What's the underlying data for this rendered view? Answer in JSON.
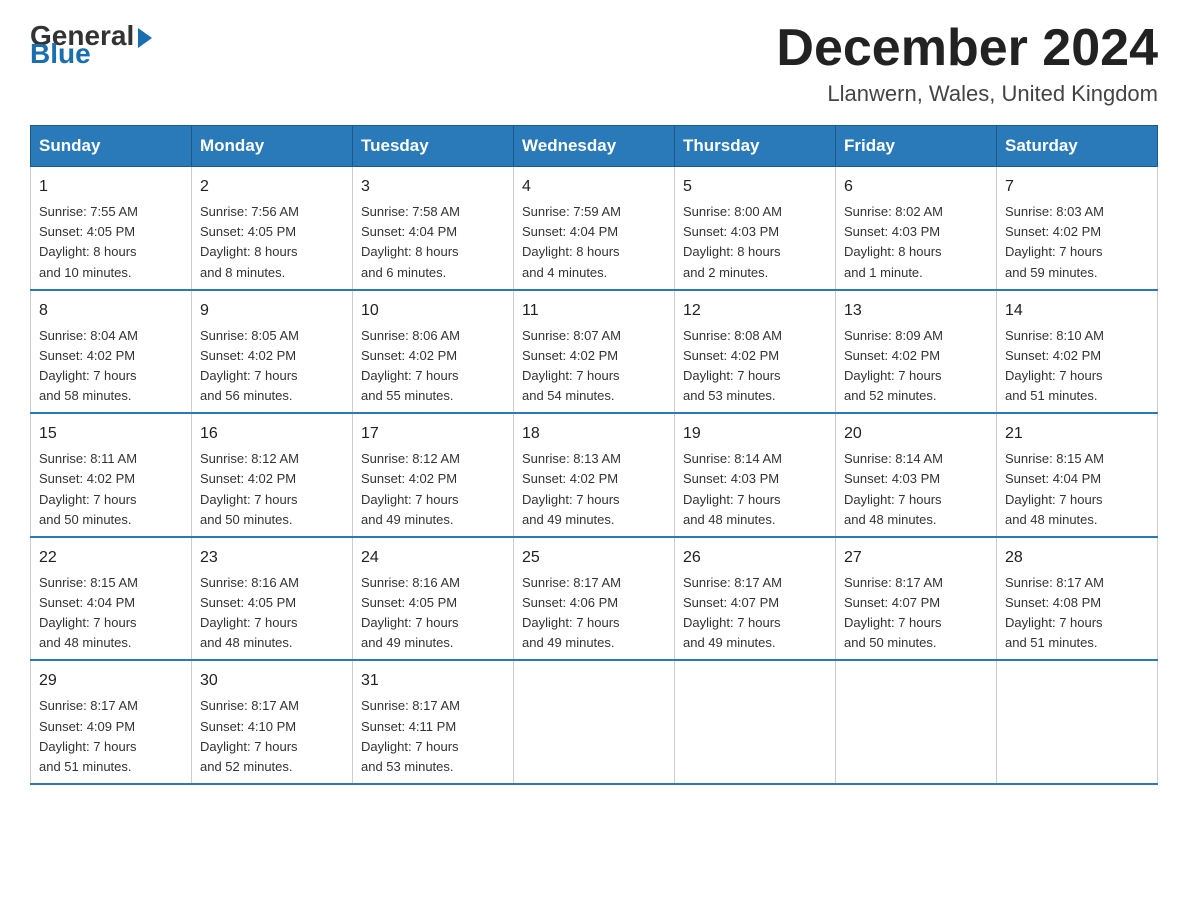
{
  "logo": {
    "general": "General",
    "blue": "Blue"
  },
  "title": "December 2024",
  "subtitle": "Llanwern, Wales, United Kingdom",
  "headers": [
    "Sunday",
    "Monday",
    "Tuesday",
    "Wednesday",
    "Thursday",
    "Friday",
    "Saturday"
  ],
  "weeks": [
    [
      {
        "day": "1",
        "sunrise": "7:55 AM",
        "sunset": "4:05 PM",
        "daylight": "8 hours and 10 minutes."
      },
      {
        "day": "2",
        "sunrise": "7:56 AM",
        "sunset": "4:05 PM",
        "daylight": "8 hours and 8 minutes."
      },
      {
        "day": "3",
        "sunrise": "7:58 AM",
        "sunset": "4:04 PM",
        "daylight": "8 hours and 6 minutes."
      },
      {
        "day": "4",
        "sunrise": "7:59 AM",
        "sunset": "4:04 PM",
        "daylight": "8 hours and 4 minutes."
      },
      {
        "day": "5",
        "sunrise": "8:00 AM",
        "sunset": "4:03 PM",
        "daylight": "8 hours and 2 minutes."
      },
      {
        "day": "6",
        "sunrise": "8:02 AM",
        "sunset": "4:03 PM",
        "daylight": "8 hours and 1 minute."
      },
      {
        "day": "7",
        "sunrise": "8:03 AM",
        "sunset": "4:02 PM",
        "daylight": "7 hours and 59 minutes."
      }
    ],
    [
      {
        "day": "8",
        "sunrise": "8:04 AM",
        "sunset": "4:02 PM",
        "daylight": "7 hours and 58 minutes."
      },
      {
        "day": "9",
        "sunrise": "8:05 AM",
        "sunset": "4:02 PM",
        "daylight": "7 hours and 56 minutes."
      },
      {
        "day": "10",
        "sunrise": "8:06 AM",
        "sunset": "4:02 PM",
        "daylight": "7 hours and 55 minutes."
      },
      {
        "day": "11",
        "sunrise": "8:07 AM",
        "sunset": "4:02 PM",
        "daylight": "7 hours and 54 minutes."
      },
      {
        "day": "12",
        "sunrise": "8:08 AM",
        "sunset": "4:02 PM",
        "daylight": "7 hours and 53 minutes."
      },
      {
        "day": "13",
        "sunrise": "8:09 AM",
        "sunset": "4:02 PM",
        "daylight": "7 hours and 52 minutes."
      },
      {
        "day": "14",
        "sunrise": "8:10 AM",
        "sunset": "4:02 PM",
        "daylight": "7 hours and 51 minutes."
      }
    ],
    [
      {
        "day": "15",
        "sunrise": "8:11 AM",
        "sunset": "4:02 PM",
        "daylight": "7 hours and 50 minutes."
      },
      {
        "day": "16",
        "sunrise": "8:12 AM",
        "sunset": "4:02 PM",
        "daylight": "7 hours and 50 minutes."
      },
      {
        "day": "17",
        "sunrise": "8:12 AM",
        "sunset": "4:02 PM",
        "daylight": "7 hours and 49 minutes."
      },
      {
        "day": "18",
        "sunrise": "8:13 AM",
        "sunset": "4:02 PM",
        "daylight": "7 hours and 49 minutes."
      },
      {
        "day": "19",
        "sunrise": "8:14 AM",
        "sunset": "4:03 PM",
        "daylight": "7 hours and 48 minutes."
      },
      {
        "day": "20",
        "sunrise": "8:14 AM",
        "sunset": "4:03 PM",
        "daylight": "7 hours and 48 minutes."
      },
      {
        "day": "21",
        "sunrise": "8:15 AM",
        "sunset": "4:04 PM",
        "daylight": "7 hours and 48 minutes."
      }
    ],
    [
      {
        "day": "22",
        "sunrise": "8:15 AM",
        "sunset": "4:04 PM",
        "daylight": "7 hours and 48 minutes."
      },
      {
        "day": "23",
        "sunrise": "8:16 AM",
        "sunset": "4:05 PM",
        "daylight": "7 hours and 48 minutes."
      },
      {
        "day": "24",
        "sunrise": "8:16 AM",
        "sunset": "4:05 PM",
        "daylight": "7 hours and 49 minutes."
      },
      {
        "day": "25",
        "sunrise": "8:17 AM",
        "sunset": "4:06 PM",
        "daylight": "7 hours and 49 minutes."
      },
      {
        "day": "26",
        "sunrise": "8:17 AM",
        "sunset": "4:07 PM",
        "daylight": "7 hours and 49 minutes."
      },
      {
        "day": "27",
        "sunrise": "8:17 AM",
        "sunset": "4:07 PM",
        "daylight": "7 hours and 50 minutes."
      },
      {
        "day": "28",
        "sunrise": "8:17 AM",
        "sunset": "4:08 PM",
        "daylight": "7 hours and 51 minutes."
      }
    ],
    [
      {
        "day": "29",
        "sunrise": "8:17 AM",
        "sunset": "4:09 PM",
        "daylight": "7 hours and 51 minutes."
      },
      {
        "day": "30",
        "sunrise": "8:17 AM",
        "sunset": "4:10 PM",
        "daylight": "7 hours and 52 minutes."
      },
      {
        "day": "31",
        "sunrise": "8:17 AM",
        "sunset": "4:11 PM",
        "daylight": "7 hours and 53 minutes."
      },
      null,
      null,
      null,
      null
    ]
  ],
  "labels": {
    "sunrise": "Sunrise:",
    "sunset": "Sunset:",
    "daylight": "Daylight:"
  }
}
